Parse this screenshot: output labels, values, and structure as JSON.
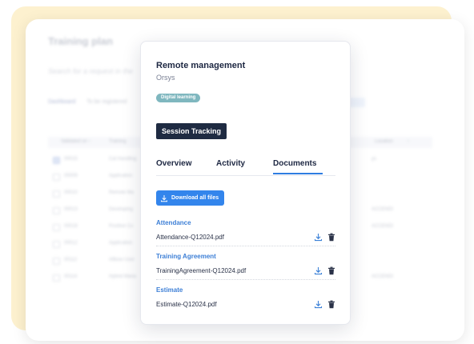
{
  "background": {
    "title": "Training plan",
    "search_placeholder": "Search for a request in the",
    "tabs": [
      "Dashboard",
      "To be registered"
    ],
    "columns": [
      "Validated on ↑",
      "Training",
      "Location",
      "↑"
    ],
    "rows": [
      {
        "id": "00015",
        "training": "Cal Handling",
        "location": "ys",
        "checked": true
      },
      {
        "id": "00009",
        "training": "Application",
        "location": "",
        "checked": false
      },
      {
        "id": "00010",
        "training": "Remote Ma",
        "location": "",
        "checked": false
      },
      {
        "id": "00013",
        "training": "Developing",
        "location": "ACCENDI",
        "checked": false
      },
      {
        "id": "00018",
        "training": "Positive Co",
        "location": "ACCENDI",
        "checked": false
      },
      {
        "id": "00012",
        "training": "Application",
        "location": "",
        "checked": false
      },
      {
        "id": "00112",
        "training": "Allbow User",
        "location": "",
        "checked": false
      },
      {
        "id": "00114",
        "training": "Hybrid Mana",
        "location": "ACCENDI",
        "checked": false
      }
    ]
  },
  "modal": {
    "course_title": "Remote management",
    "provider": "Orsys",
    "badge": "Digital learning",
    "session_button": "Session Tracking",
    "tabs": [
      "Overview",
      "Activity",
      "Documents"
    ],
    "active_tab": "Documents",
    "download_all_label": "Download all files",
    "sections": [
      {
        "label": "Attendance",
        "file": "Attendance-Q12024.pdf"
      },
      {
        "label": "Training Agreement",
        "file": "TrainingAgreement-Q12024.pdf"
      },
      {
        "label": "Estimate",
        "file": "Estimate-Q12024.pdf"
      }
    ]
  },
  "colors": {
    "accent": "#3385ec",
    "dark_button": "#1f2b42",
    "badge": "#7fb7bf",
    "section_label": "#3d7fd6",
    "decor_yellow": "#fdf1cf"
  },
  "icons": [
    "download-icon",
    "trash-icon"
  ]
}
